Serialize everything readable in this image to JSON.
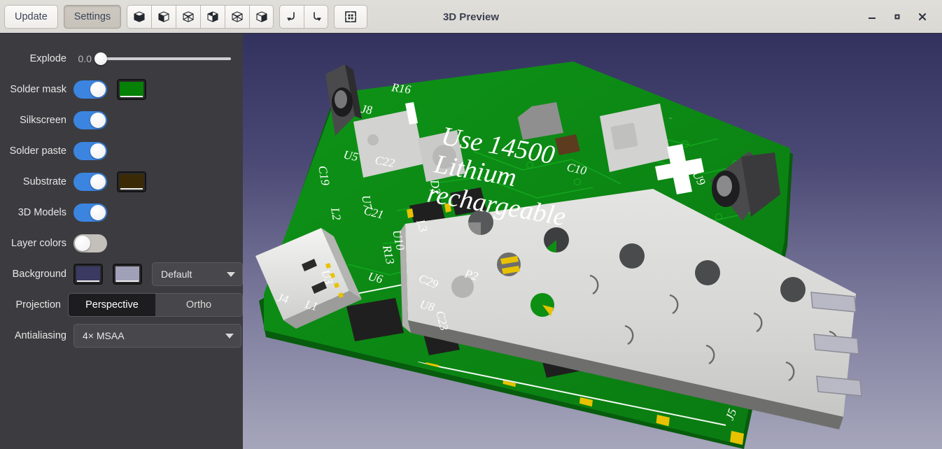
{
  "window": {
    "title": "3D Preview",
    "controls": [
      {
        "name": "minimize",
        "glyph": "minimize-icon"
      },
      {
        "name": "maximize",
        "glyph": "maximize-icon"
      },
      {
        "name": "close",
        "glyph": "close-icon"
      }
    ]
  },
  "toolbar": {
    "update_label": "Update",
    "settings_label": "Settings",
    "view_icons": [
      "cube-front-icon",
      "cube-back-icon",
      "cube-top-icon",
      "cube-bottom-icon",
      "cube-left-icon",
      "cube-right-icon"
    ],
    "rotate_left_icon": "rotate-left-icon",
    "rotate_right_icon": "rotate-right-icon",
    "fit_icon": "zoom-to-fit-icon"
  },
  "sidebar": {
    "explode": {
      "label": "Explode",
      "value": "0.0",
      "min": 0,
      "max": 1,
      "percent": 0
    },
    "solder_mask": {
      "label": "Solder mask",
      "enabled": true,
      "color": "#068006"
    },
    "silkscreen": {
      "label": "Silkscreen",
      "enabled": true
    },
    "solder_paste": {
      "label": "Solder paste",
      "enabled": true
    },
    "substrate": {
      "label": "Substrate",
      "enabled": true,
      "color": "#3b2a06"
    },
    "models_3d": {
      "label": "3D Models",
      "enabled": true
    },
    "layer_colors": {
      "label": "Layer colors",
      "enabled": false
    },
    "background": {
      "label": "Background",
      "top_color": "#3a3a63",
      "bottom_color": "#a0a0b8",
      "preset": "Default"
    },
    "projection": {
      "label": "Projection",
      "options": [
        "Perspective",
        "Ortho"
      ],
      "selected": "Perspective"
    },
    "antialiasing": {
      "label": "Antialiasing",
      "value": "4× MSAA"
    }
  },
  "viewport": {
    "scene": "pcb-3d-render",
    "board_color": "#0d8f14",
    "board_dark": "#0a6b10",
    "silkscreen_color": "#ffffff",
    "pad_color": "#e8c200",
    "copper_color": "#0fa81a",
    "silkscreen_text": [
      "Use 14500",
      "Lithium",
      "rechargeable",
      "+"
    ],
    "designators": [
      "R16",
      "J8",
      "C10",
      "C19",
      "U5",
      "C22",
      "D2",
      "L2",
      "U7",
      "C21",
      "L3",
      "R13",
      "U10",
      "U3",
      "U8",
      "J4",
      "L1",
      "U6",
      "C29",
      "P2",
      "C23",
      "J5",
      "U9"
    ]
  }
}
